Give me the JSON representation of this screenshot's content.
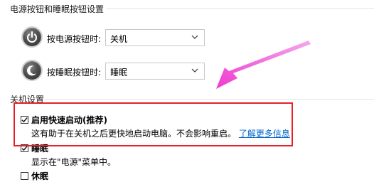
{
  "power_buttons_section": {
    "title": "电源按钮和睡眠按钮设置",
    "power_button_label": "按电源按钮时:",
    "power_button_value": "关机",
    "sleep_button_label": "按睡眠按钮时:",
    "sleep_button_value": "睡眠"
  },
  "shutdown_section": {
    "title": "关机设置",
    "fast_startup": {
      "label": "启用快速启动(推荐)",
      "checked": true,
      "description": "这有助于在关机之后更快地启动电脑。不会影响重启。",
      "link": "了解更多信息"
    },
    "sleep": {
      "label": "睡眠",
      "checked": true,
      "description": "显示在\"电源\"菜单中。"
    },
    "hibernate": {
      "label": "休眠",
      "checked": false
    }
  },
  "colors": {
    "highlight_border": "#e8202a",
    "arrow": "#ee3bd0",
    "link": "#0066cc"
  },
  "icons": [
    "power-icon",
    "sleep-icon",
    "chevron-down-icon",
    "checkmark-icon",
    "arrow-annotation"
  ]
}
